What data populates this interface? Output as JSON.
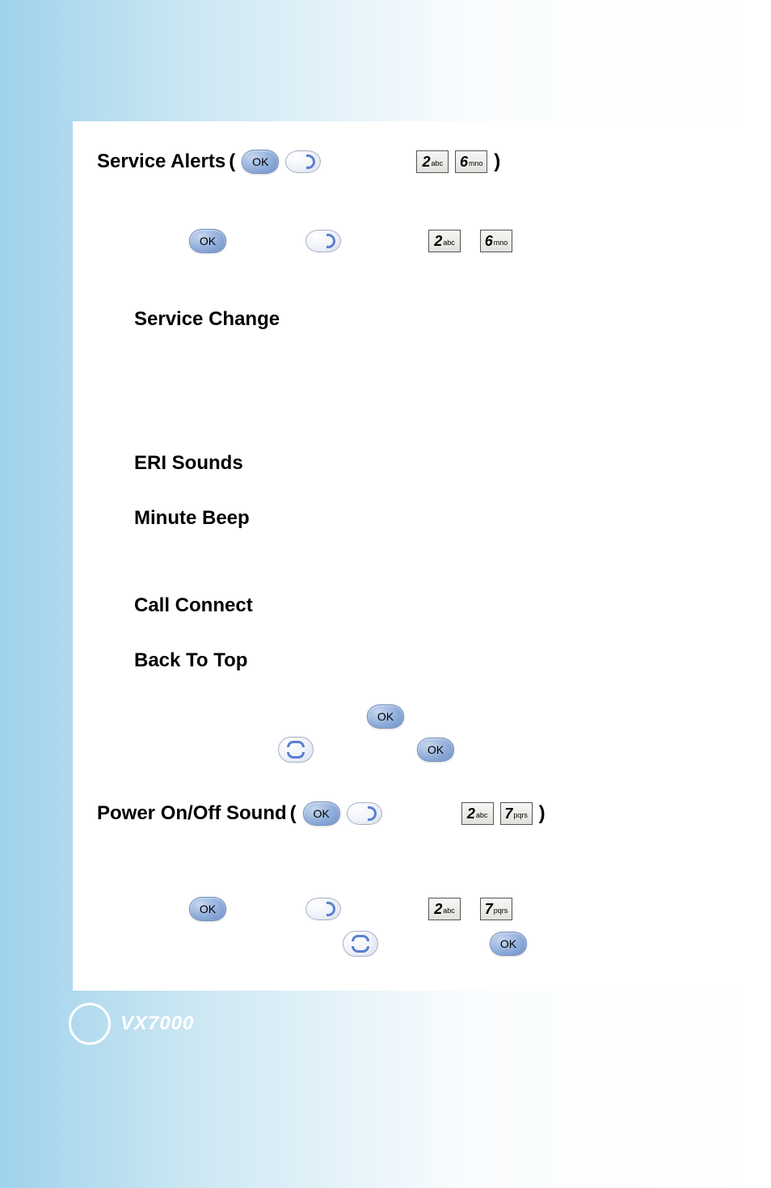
{
  "section1": {
    "title": "Service Alerts",
    "ok_label": "OK",
    "key1": {
      "digit": "2",
      "letters": "abc"
    },
    "key2": {
      "digit": "6",
      "letters": "mno"
    }
  },
  "section1_row2": {
    "ok_label": "OK",
    "key1": {
      "digit": "2",
      "letters": "abc"
    },
    "key2": {
      "digit": "6",
      "letters": "mno"
    }
  },
  "subs": {
    "service_change": "Service Change",
    "eri_sounds": "ERI Sounds",
    "minute_beep": "Minute Beep",
    "call_connect": "Call Connect",
    "back_to_top": "Back To Top"
  },
  "mid_row": {
    "ok1_label": "OK",
    "ok2_label": "OK"
  },
  "section2": {
    "title": "Power On/Off Sound",
    "ok_label": "OK",
    "key1": {
      "digit": "2",
      "letters": "abc"
    },
    "key2": {
      "digit": "7",
      "letters": "pqrs"
    }
  },
  "section2_row2": {
    "ok_label": "OK",
    "key1": {
      "digit": "2",
      "letters": "abc"
    },
    "key2": {
      "digit": "7",
      "letters": "pqrs"
    },
    "ok2_label": "OK"
  },
  "footer": {
    "brand": "VX7000"
  }
}
